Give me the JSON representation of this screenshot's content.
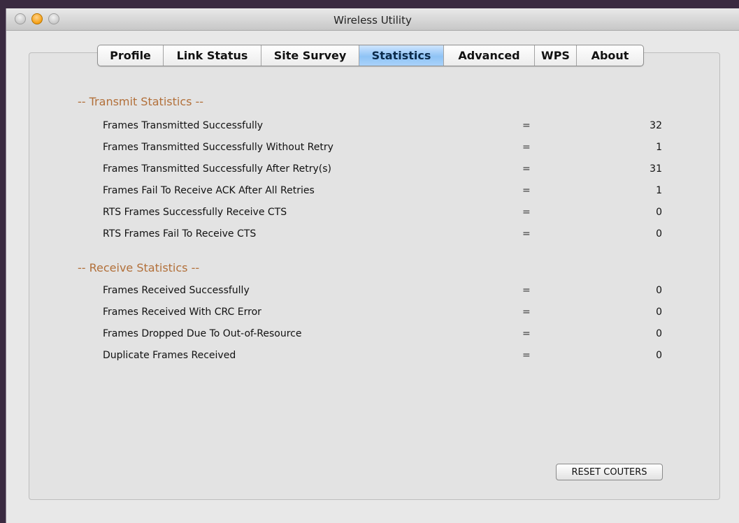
{
  "window": {
    "title": "Wireless Utility"
  },
  "tabs": [
    {
      "label": "Profile",
      "active": false
    },
    {
      "label": "Link Status",
      "active": false
    },
    {
      "label": "Site Survey",
      "active": false
    },
    {
      "label": "Statistics",
      "active": true
    },
    {
      "label": "Advanced",
      "active": false
    },
    {
      "label": "WPS",
      "active": false
    },
    {
      "label": "About",
      "active": false
    }
  ],
  "transmit": {
    "title": "-- Transmit Statistics --",
    "rows": [
      {
        "label": "Frames Transmitted Successfully",
        "eq": "=",
        "value": "32"
      },
      {
        "label": "Frames Transmitted Successfully Without Retry",
        "eq": "=",
        "value": "1"
      },
      {
        "label": "Frames Transmitted Successfully After Retry(s)",
        "eq": "=",
        "value": "31"
      },
      {
        "label": "Frames Fail To Receive ACK After All Retries",
        "eq": "=",
        "value": "1"
      },
      {
        "label": "RTS Frames Successfully Receive CTS",
        "eq": "=",
        "value": "0"
      },
      {
        "label": "RTS Frames Fail To Receive CTS",
        "eq": "=",
        "value": "0"
      }
    ]
  },
  "receive": {
    "title": "-- Receive Statistics --",
    "rows": [
      {
        "label": "Frames Received Successfully",
        "eq": "=",
        "value": "0"
      },
      {
        "label": "Frames Received With CRC Error",
        "eq": "=",
        "value": "0"
      },
      {
        "label": "Frames Dropped Due To Out-of-Resource",
        "eq": "=",
        "value": "0"
      },
      {
        "label": "Duplicate Frames Received",
        "eq": "=",
        "value": "0"
      }
    ]
  },
  "reset_button": {
    "label": "RESET COUTERS"
  },
  "colors": {
    "section_title": "#b2703a",
    "active_tab": "#8fc3f5"
  }
}
